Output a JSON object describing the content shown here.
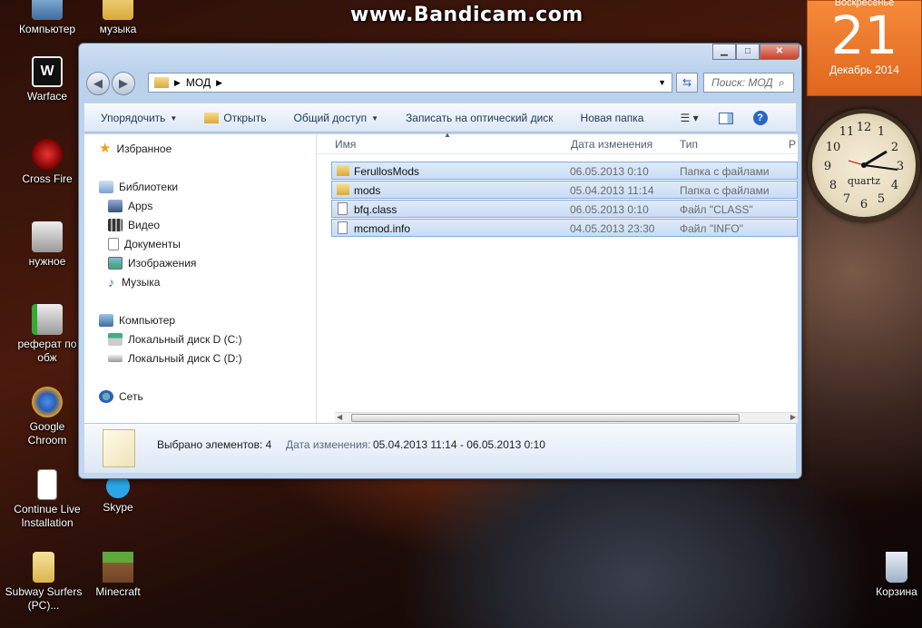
{
  "watermark": "www.Bandicam.com",
  "desktop_icons": [
    "Компьютер",
    "музыка",
    "Warface",
    "Cross Fire",
    "нужное",
    "реферат по обж",
    "Google Chroom",
    "Continue Live Installation",
    "Skype",
    "Subway Surfers (PC)...",
    "Minecraft",
    "Корзина"
  ],
  "calendar": {
    "day_name": "Воскресенье",
    "day": "21",
    "month_year": "Декабрь 2014"
  },
  "clock": {
    "brand": "quartz",
    "numbers": [
      "12",
      "1",
      "2",
      "3",
      "4",
      "5",
      "6",
      "7",
      "8",
      "9",
      "10",
      "11"
    ]
  },
  "window": {
    "address": {
      "folder": "МОД",
      "search_placeholder": "Поиск: МОД"
    },
    "toolbar": {
      "organize": "Упорядочить",
      "open": "Открыть",
      "share": "Общий доступ",
      "burn": "Записать на оптический диск",
      "new_folder": "Новая папка"
    },
    "nav": {
      "favorites": "Избранное",
      "libraries": "Библиотеки",
      "lib_items": [
        "Apps",
        "Видео",
        "Документы",
        "Изображения",
        "Музыка"
      ],
      "computer": "Компьютер",
      "drives": [
        "Локальный диск D (C:)",
        "Локальный диск C (D:)"
      ],
      "network": "Сеть"
    },
    "columns": {
      "name": "Имя",
      "date": "Дата изменения",
      "type": "Тип",
      "size": "Р"
    },
    "files": [
      {
        "name": "FerullosMods",
        "date": "06.05.2013 0:10",
        "type": "Папка с файлами",
        "kind": "folder"
      },
      {
        "name": "mods",
        "date": "05.04.2013 11:14",
        "type": "Папка с файлами",
        "kind": "folder"
      },
      {
        "name": "bfq.class",
        "date": "06.05.2013 0:10",
        "type": "Файл \"CLASS\"",
        "kind": "file"
      },
      {
        "name": "mcmod.info",
        "date": "04.05.2013 23:30",
        "type": "Файл \"INFO\"",
        "kind": "file"
      }
    ],
    "details": {
      "selected": "Выбрано элементов: 4",
      "date_label": "Дата изменения:",
      "date_range": "05.04.2013 11:14 - 06.05.2013 0:10"
    }
  },
  "colors": {
    "folder": "#e8c45a",
    "selection": "#c9dcf5",
    "calendar": "#ef7a2c"
  }
}
